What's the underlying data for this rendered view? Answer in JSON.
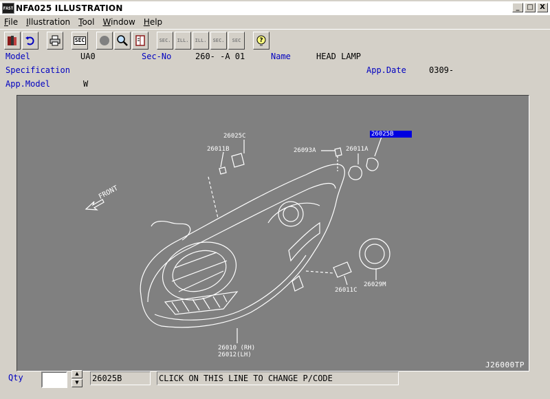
{
  "window": {
    "app_icon_text": "FAST",
    "title": "NFA025 ILLUSTRATION",
    "minimize": "_",
    "maximize": "□",
    "close": "X"
  },
  "menu": [
    {
      "label": "File",
      "u": "F",
      "rest": "ile"
    },
    {
      "label": "Illustration",
      "u": "I",
      "rest": "llustration"
    },
    {
      "label": "Tool",
      "u": "T",
      "rest": "ool"
    },
    {
      "label": "Window",
      "u": "W",
      "rest": "indow"
    },
    {
      "label": "Help",
      "u": "H",
      "rest": "elp"
    }
  ],
  "toolbar": {
    "sec_label": "SEC",
    "sec_prev": "SEC.",
    "ill_prev": "ILL.",
    "ill_next": "ILL.",
    "sec_next": "SEC.",
    "sec_query": "SEC"
  },
  "info": {
    "model_label": "Model",
    "model_value": "UA0",
    "secno_label": "Sec-No",
    "secno_value": "260-  -A 01",
    "name_label": "Name",
    "name_value": "HEAD LAMP",
    "spec_label": "Specification",
    "appdate_label": "App.Date",
    "appdate_value": "0309-",
    "appmodel_label": "App.Model",
    "appmodel_value": "W"
  },
  "illustration": {
    "callouts": [
      {
        "id": "26025C",
        "text": "26025C"
      },
      {
        "id": "26011B",
        "text": "26011B"
      },
      {
        "id": "26093A",
        "text": "26093A"
      },
      {
        "id": "26011A",
        "text": "26011A"
      },
      {
        "id": "26025B",
        "text": "26025B",
        "selected": true
      },
      {
        "id": "26011C",
        "text": "26011C"
      },
      {
        "id": "26029M",
        "text": "26029M"
      },
      {
        "id": "26010",
        "text": "26010 (RH)"
      },
      {
        "id": "26012",
        "text": "26012(LH)"
      }
    ],
    "front_label": "FRONT",
    "drawing_id": "J26000TP"
  },
  "bottom": {
    "qty_label": "Qty",
    "qty_value": "",
    "part_no": "26025B",
    "message": "CLICK ON THIS LINE TO CHANGE P/CODE"
  },
  "colors": {
    "label_blue": "#0000c0",
    "panel_gray": "#808080",
    "selection_blue": "#0000e0",
    "chrome": "#d4d0c8"
  }
}
